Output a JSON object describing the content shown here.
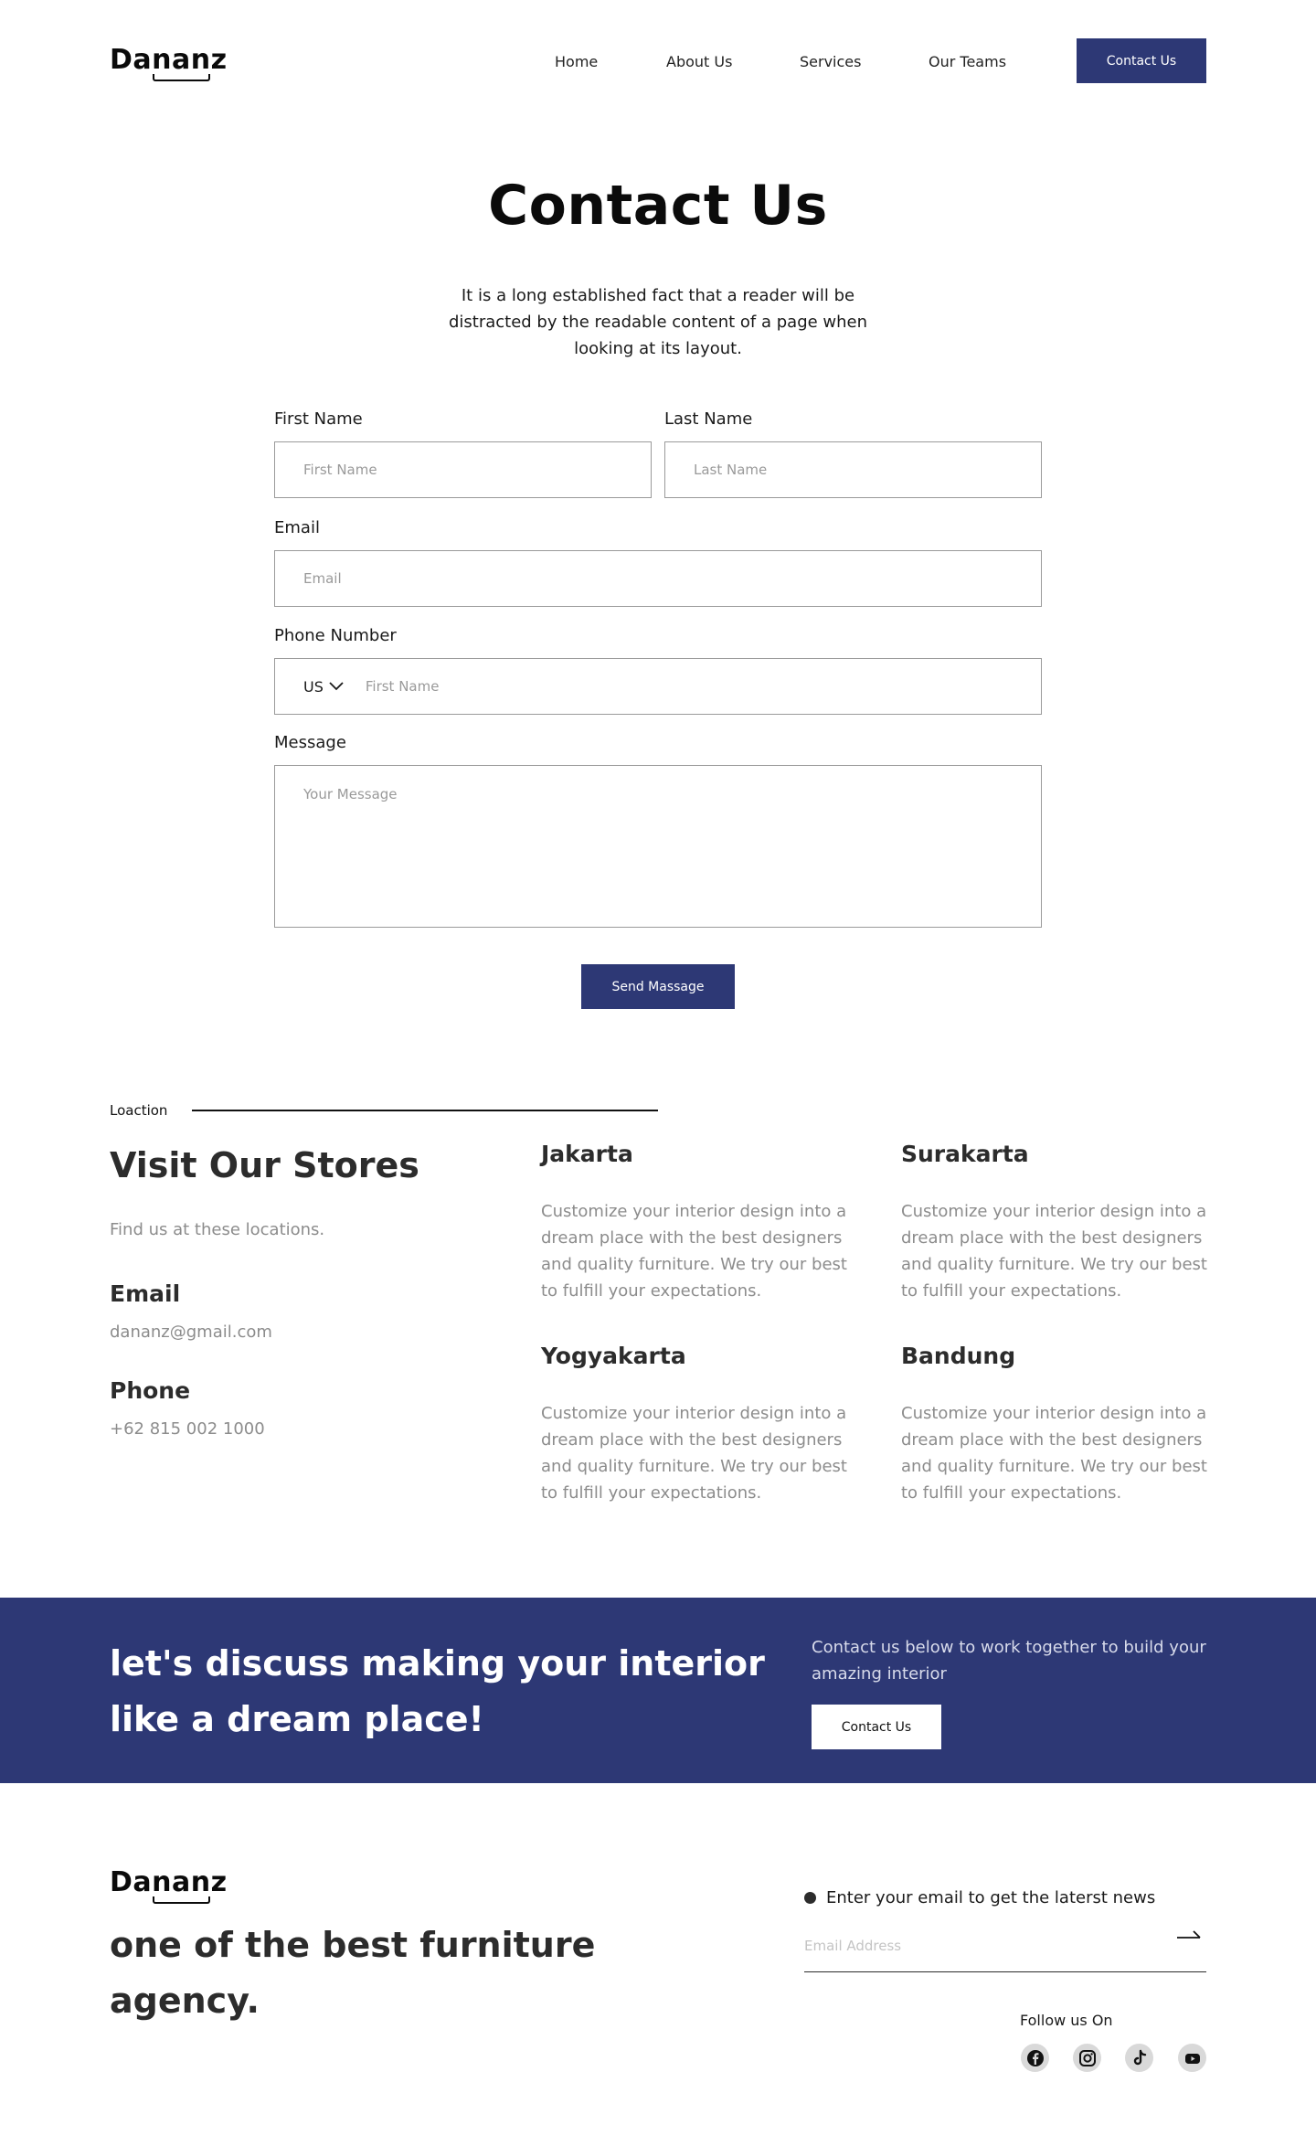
{
  "header": {
    "logo": {
      "pre": "Da",
      "mid": "nan",
      "post": "z"
    },
    "nav": [
      "Home",
      "About Us",
      "Services",
      "Our Teams"
    ],
    "cta": "Contact Us"
  },
  "hero": {
    "title": "Contact Us",
    "intro": [
      "It is a long established fact that a reader will be",
      "distracted by the readable content of a page when",
      "looking at its layout."
    ]
  },
  "form": {
    "first_name": {
      "label": "First Name",
      "placeholder": "First Name"
    },
    "last_name": {
      "label": "Last Name",
      "placeholder": "Last Name"
    },
    "email": {
      "label": "Email",
      "placeholder": "Email"
    },
    "phone": {
      "label": "Phone Number",
      "country": "US",
      "placeholder": "First Name"
    },
    "message": {
      "label": "Message",
      "placeholder": "Your Message"
    },
    "submit": "Send Massage"
  },
  "locations": {
    "kicker": "Loaction",
    "heading": "Visit Our Stores",
    "subheading": "Find us at these locations.",
    "email_label": "Email",
    "email_value": "dananz@gmail.com",
    "phone_label": "Phone",
    "phone_value": "+62 815 002 1000",
    "stores": [
      {
        "city": "Jakarta",
        "desc": [
          "Customize your interior design into a",
          "dream place with the best designers",
          "and quality furniture. We try our best",
          "to fulfill your expectations."
        ]
      },
      {
        "city": "Surakarta",
        "desc": [
          "Customize your interior design into a",
          "dream place with the best designers",
          "and quality furniture. We try our best",
          "to fulfill your expectations."
        ]
      },
      {
        "city": "Yogyakarta",
        "desc": [
          "Customize your interior design into a",
          "dream place with the best designers",
          "and quality furniture. We try our best",
          "to fulfill your expectations."
        ]
      },
      {
        "city": "Bandung",
        "desc": [
          "Customize your interior design into a",
          "dream place with the best designers",
          "and quality furniture. We try our best",
          "to fulfill your expectations."
        ]
      }
    ]
  },
  "banner": {
    "heading": [
      "let's discuss making your interior",
      "like a dream place!"
    ],
    "text": [
      "Contact us below to work together to build your",
      "amazing interior"
    ],
    "button": "Contact Us",
    "color": "#2d3875"
  },
  "footer": {
    "logo": {
      "pre": "Da",
      "mid": "nan",
      "post": "z"
    },
    "tagline": [
      "one of the best furniture",
      "agency."
    ],
    "newsletter_label": "Enter  your email to get the laterst news",
    "email_placeholder": "Email Address",
    "follow_label": "Follow us On",
    "socials": [
      "facebook-icon",
      "instagram-icon",
      "tiktok-icon",
      "youtube-icon"
    ]
  }
}
